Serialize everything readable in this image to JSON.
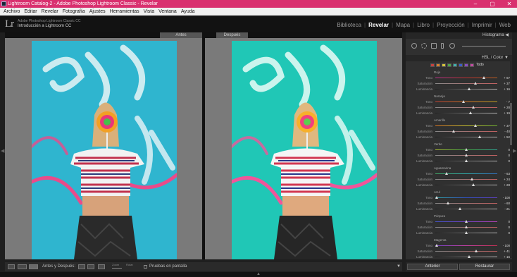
{
  "window": {
    "title": "Lightroom Catalog-2 - Adobe Photoshop Lightroom Classic - Revelar",
    "controls": [
      "–",
      "▢",
      "✕"
    ]
  },
  "menu": [
    "Archivo",
    "Editar",
    "Revelar",
    "Fotografía",
    "Ajustes",
    "Herramientas",
    "Vista",
    "Ventana",
    "Ayuda"
  ],
  "identity": {
    "logo": "Lr",
    "small": "Adobe Photoshop Lightroom Classic CC",
    "name": "Introducción a Lightroom CC"
  },
  "modules": [
    {
      "label": "Biblioteca",
      "active": false
    },
    {
      "label": "Revelar",
      "active": true
    },
    {
      "label": "Mapa",
      "active": false
    },
    {
      "label": "Libro",
      "active": false
    },
    {
      "label": "Proyección",
      "active": false
    },
    {
      "label": "Imprimir",
      "active": false
    },
    {
      "label": "Web",
      "active": false
    }
  ],
  "compare": {
    "before_label": "Antes",
    "after_label": "Después"
  },
  "panels": {
    "histogram": "Histograma",
    "hsl": "HSL / Color",
    "all": "Todo"
  },
  "hsl_groups": [
    {
      "name": "Rojo",
      "rows": [
        {
          "label": "Tono",
          "value": "+ 67",
          "pos": 0.78
        },
        {
          "label": "Saturación",
          "value": "+ 37",
          "pos": 0.65
        },
        {
          "label": "Luminancia",
          "value": "+ 16",
          "pos": 0.55
        }
      ]
    },
    {
      "name": "Naranja",
      "rows": [
        {
          "label": "Tono",
          "value": "- 7",
          "pos": 0.46
        },
        {
          "label": "Saturación",
          "value": "+ 28",
          "pos": 0.61
        },
        {
          "label": "Luminancia",
          "value": "+ 19",
          "pos": 0.57
        }
      ]
    },
    {
      "name": "Amarillo",
      "rows": [
        {
          "label": "Tono",
          "value": "+ 37",
          "pos": 0.65
        },
        {
          "label": "Saturación",
          "value": "- 40",
          "pos": 0.3
        },
        {
          "label": "Luminancia",
          "value": "+ 52",
          "pos": 0.72
        }
      ]
    },
    {
      "name": "Verde",
      "rows": [
        {
          "label": "Tono",
          "value": "0",
          "pos": 0.5
        },
        {
          "label": "Saturación",
          "value": "0",
          "pos": 0.5
        },
        {
          "label": "Luminancia",
          "value": "0",
          "pos": 0.5
        }
      ]
    },
    {
      "name": "Aguamarina",
      "rows": [
        {
          "label": "Tono",
          "value": "- 63",
          "pos": 0.18
        },
        {
          "label": "Saturación",
          "value": "+ 24",
          "pos": 0.59
        },
        {
          "label": "Luminancia",
          "value": "+ 28",
          "pos": 0.61
        }
      ]
    },
    {
      "name": "Azul",
      "rows": [
        {
          "label": "Tono",
          "value": "- 100",
          "pos": 0.02
        },
        {
          "label": "Saturación",
          "value": "- 60",
          "pos": 0.2
        },
        {
          "label": "Luminancia",
          "value": "- 21",
          "pos": 0.4
        }
      ]
    },
    {
      "name": "Púrpura",
      "rows": [
        {
          "label": "Tono",
          "value": "0",
          "pos": 0.5
        },
        {
          "label": "Saturación",
          "value": "0",
          "pos": 0.5
        },
        {
          "label": "Luminancia",
          "value": "0",
          "pos": 0.5
        }
      ]
    },
    {
      "name": "Magenta",
      "rows": [
        {
          "label": "Tono",
          "value": "- 100",
          "pos": 0.02
        },
        {
          "label": "Saturación",
          "value": "+ 41",
          "pos": 0.66
        },
        {
          "label": "Luminancia",
          "value": "+ 16",
          "pos": 0.55
        }
      ]
    }
  ],
  "toolbar": {
    "view_label": "Antes y Después:",
    "zoom_small": "Zoom",
    "rotate_small": "Rotar",
    "proof": "Pruebas en pantalla"
  },
  "buttons": {
    "previous": "Anterior",
    "reset": "Restaurar"
  },
  "colors": {
    "titlebar": "#d9306f",
    "before_wall": "#2fb5cf",
    "after_wall": "#20c7b6"
  }
}
